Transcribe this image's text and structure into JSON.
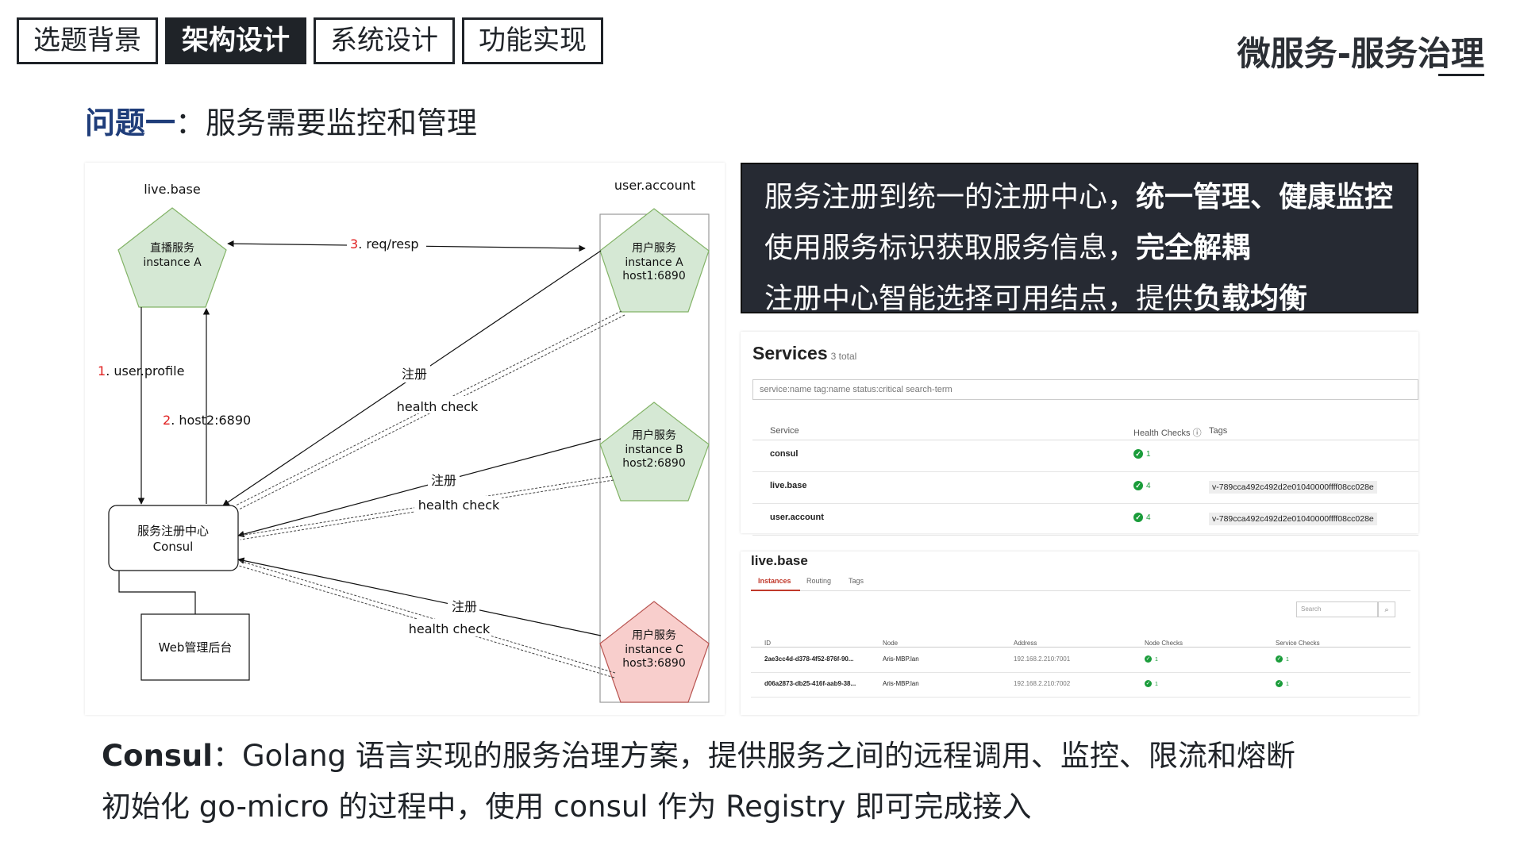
{
  "nav": {
    "tabs": [
      {
        "label": "选题背景",
        "active": false
      },
      {
        "label": "架构设计",
        "active": true
      },
      {
        "label": "系统设计",
        "active": false
      },
      {
        "label": "功能实现",
        "active": false
      }
    ]
  },
  "brand": "微服务-服务治理",
  "question": {
    "label": "问题一",
    "sep": "：",
    "text": "服务需要监控和管理"
  },
  "diagram": {
    "live_base_label": "live.base",
    "user_account_label": "user.account",
    "live_node": {
      "line1": "直播服务",
      "line2": "instance A"
    },
    "user_a": {
      "line1": "用户服务",
      "line2": "instance A",
      "line3": "host1:6890"
    },
    "user_b": {
      "line1": "用户服务",
      "line2": "instance B",
      "line3": "host2:6890"
    },
    "user_c": {
      "line1": "用户服务",
      "line2": "instance C",
      "line3": "host3:6890"
    },
    "consul": {
      "line1": "服务注册中心",
      "line2": "Consul"
    },
    "web": "Web管理后台",
    "step1": {
      "num": "1",
      "text": ". user.profile"
    },
    "step2": {
      "num": "2",
      "text": ". host2:6890"
    },
    "step3": {
      "num": "3",
      "text": ". req/resp"
    },
    "register": "注册",
    "health_check": "health check",
    "colors": {
      "green_fill": "#d5e8d4",
      "green_stroke": "#82b366",
      "red_fill": "#f8cecc",
      "red_stroke": "#b85450",
      "step_num": "#e02020"
    }
  },
  "dark_box": {
    "line1": {
      "plain": "服务注册到统一的注册中心，",
      "bold": "统一管理、健康监控"
    },
    "line2": {
      "plain": "使用服务标识获取服务信息，",
      "bold": "完全解耦"
    },
    "line3": {
      "plain": "注册中心智能选择可用结点，提供",
      "bold": "负载均衡"
    }
  },
  "services": {
    "title": "Services",
    "total": "3 total",
    "search_placeholder": "service:name tag:name status:critical search-term",
    "headers": {
      "service": "Service",
      "health": "Health Checks ⓘ",
      "tags": "Tags"
    },
    "rows": [
      {
        "name": "consul",
        "checks": "1",
        "tag": ""
      },
      {
        "name": "live.base",
        "checks": "4",
        "tag": "v-789cca492c492d2e01040000ffff08cc028e"
      },
      {
        "name": "user.account",
        "checks": "4",
        "tag": "v-789cca492c492d2e01040000ffff08cc028e"
      }
    ]
  },
  "live_panel": {
    "title": "live.base",
    "tabs": [
      "Instances",
      "Routing",
      "Tags"
    ],
    "search_placeholder": "Search",
    "search_icon": "magnifier-icon",
    "headers": {
      "id": "ID",
      "node": "Node",
      "address": "Address",
      "node_checks": "Node Checks",
      "service_checks": "Service Checks"
    },
    "rows": [
      {
        "id": "2ae3cc4d-d378-4f52-876f-90...",
        "node": "Aris-MBP.lan",
        "address": "192.168.2.210:7001",
        "node_checks": "1",
        "service_checks": "1"
      },
      {
        "id": "d06a2873-db25-416f-aab9-38...",
        "node": "Aris-MBP.lan",
        "address": "192.168.2.210:7002",
        "node_checks": "1",
        "service_checks": "1"
      }
    ]
  },
  "footer": {
    "line1": {
      "bold": "Consul",
      "rest": "：Golang 语言实现的服务治理方案，提供服务之间的远程调用、监控、限流和熔断"
    },
    "line2": "初始化 go-micro 的过程中，使用 consul 作为 Registry 即可完成接入"
  }
}
